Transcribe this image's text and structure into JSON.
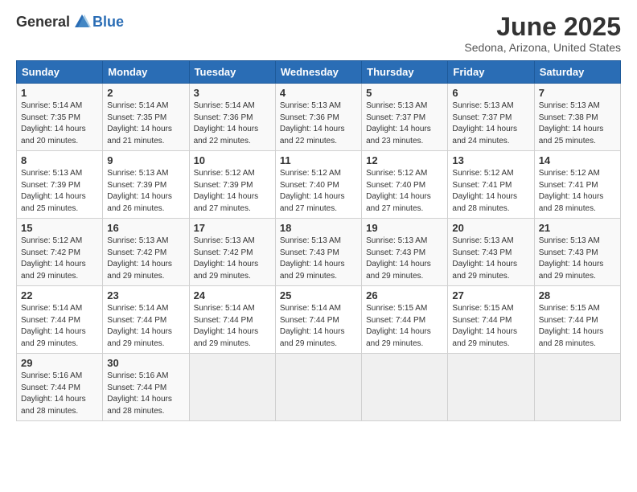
{
  "logo": {
    "general": "General",
    "blue": "Blue"
  },
  "title": "June 2025",
  "subtitle": "Sedona, Arizona, United States",
  "days_header": [
    "Sunday",
    "Monday",
    "Tuesday",
    "Wednesday",
    "Thursday",
    "Friday",
    "Saturday"
  ],
  "weeks": [
    [
      {
        "num": "1",
        "sunrise": "5:14 AM",
        "sunset": "7:35 PM",
        "daylight": "14 hours and 20 minutes."
      },
      {
        "num": "2",
        "sunrise": "5:14 AM",
        "sunset": "7:35 PM",
        "daylight": "14 hours and 21 minutes."
      },
      {
        "num": "3",
        "sunrise": "5:14 AM",
        "sunset": "7:36 PM",
        "daylight": "14 hours and 22 minutes."
      },
      {
        "num": "4",
        "sunrise": "5:13 AM",
        "sunset": "7:36 PM",
        "daylight": "14 hours and 22 minutes."
      },
      {
        "num": "5",
        "sunrise": "5:13 AM",
        "sunset": "7:37 PM",
        "daylight": "14 hours and 23 minutes."
      },
      {
        "num": "6",
        "sunrise": "5:13 AM",
        "sunset": "7:37 PM",
        "daylight": "14 hours and 24 minutes."
      },
      {
        "num": "7",
        "sunrise": "5:13 AM",
        "sunset": "7:38 PM",
        "daylight": "14 hours and 25 minutes."
      }
    ],
    [
      {
        "num": "8",
        "sunrise": "5:13 AM",
        "sunset": "7:39 PM",
        "daylight": "14 hours and 25 minutes."
      },
      {
        "num": "9",
        "sunrise": "5:13 AM",
        "sunset": "7:39 PM",
        "daylight": "14 hours and 26 minutes."
      },
      {
        "num": "10",
        "sunrise": "5:12 AM",
        "sunset": "7:39 PM",
        "daylight": "14 hours and 27 minutes."
      },
      {
        "num": "11",
        "sunrise": "5:12 AM",
        "sunset": "7:40 PM",
        "daylight": "14 hours and 27 minutes."
      },
      {
        "num": "12",
        "sunrise": "5:12 AM",
        "sunset": "7:40 PM",
        "daylight": "14 hours and 27 minutes."
      },
      {
        "num": "13",
        "sunrise": "5:12 AM",
        "sunset": "7:41 PM",
        "daylight": "14 hours and 28 minutes."
      },
      {
        "num": "14",
        "sunrise": "5:12 AM",
        "sunset": "7:41 PM",
        "daylight": "14 hours and 28 minutes."
      }
    ],
    [
      {
        "num": "15",
        "sunrise": "5:12 AM",
        "sunset": "7:42 PM",
        "daylight": "14 hours and 29 minutes."
      },
      {
        "num": "16",
        "sunrise": "5:13 AM",
        "sunset": "7:42 PM",
        "daylight": "14 hours and 29 minutes."
      },
      {
        "num": "17",
        "sunrise": "5:13 AM",
        "sunset": "7:42 PM",
        "daylight": "14 hours and 29 minutes."
      },
      {
        "num": "18",
        "sunrise": "5:13 AM",
        "sunset": "7:43 PM",
        "daylight": "14 hours and 29 minutes."
      },
      {
        "num": "19",
        "sunrise": "5:13 AM",
        "sunset": "7:43 PM",
        "daylight": "14 hours and 29 minutes."
      },
      {
        "num": "20",
        "sunrise": "5:13 AM",
        "sunset": "7:43 PM",
        "daylight": "14 hours and 29 minutes."
      },
      {
        "num": "21",
        "sunrise": "5:13 AM",
        "sunset": "7:43 PM",
        "daylight": "14 hours and 29 minutes."
      }
    ],
    [
      {
        "num": "22",
        "sunrise": "5:14 AM",
        "sunset": "7:44 PM",
        "daylight": "14 hours and 29 minutes."
      },
      {
        "num": "23",
        "sunrise": "5:14 AM",
        "sunset": "7:44 PM",
        "daylight": "14 hours and 29 minutes."
      },
      {
        "num": "24",
        "sunrise": "5:14 AM",
        "sunset": "7:44 PM",
        "daylight": "14 hours and 29 minutes."
      },
      {
        "num": "25",
        "sunrise": "5:14 AM",
        "sunset": "7:44 PM",
        "daylight": "14 hours and 29 minutes."
      },
      {
        "num": "26",
        "sunrise": "5:15 AM",
        "sunset": "7:44 PM",
        "daylight": "14 hours and 29 minutes."
      },
      {
        "num": "27",
        "sunrise": "5:15 AM",
        "sunset": "7:44 PM",
        "daylight": "14 hours and 29 minutes."
      },
      {
        "num": "28",
        "sunrise": "5:15 AM",
        "sunset": "7:44 PM",
        "daylight": "14 hours and 28 minutes."
      }
    ],
    [
      {
        "num": "29",
        "sunrise": "5:16 AM",
        "sunset": "7:44 PM",
        "daylight": "14 hours and 28 minutes."
      },
      {
        "num": "30",
        "sunrise": "5:16 AM",
        "sunset": "7:44 PM",
        "daylight": "14 hours and 28 minutes."
      },
      null,
      null,
      null,
      null,
      null
    ]
  ],
  "labels": {
    "sunrise": "Sunrise:",
    "sunset": "Sunset:",
    "daylight": "Daylight:"
  }
}
